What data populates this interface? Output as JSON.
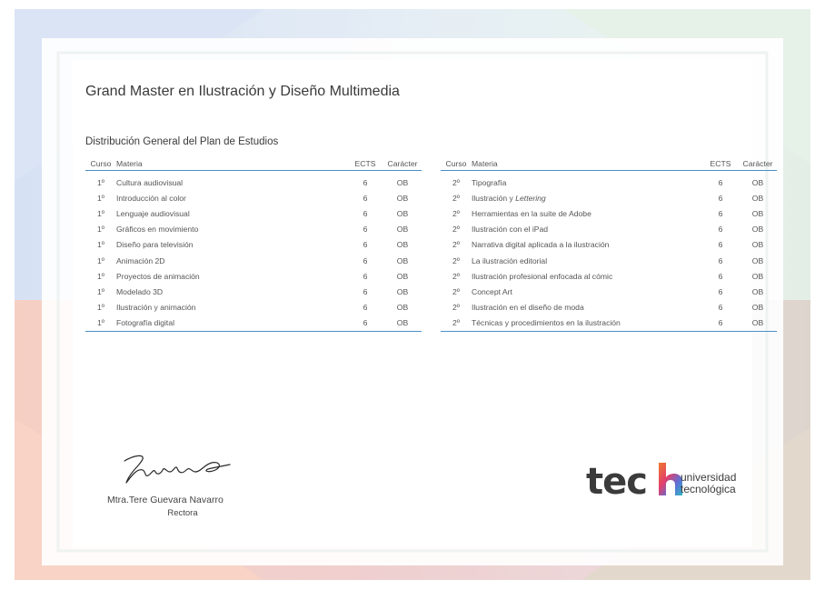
{
  "document": {
    "title": "Grand Master en Ilustración y Diseño Multimedia",
    "subtitle": "Distribución General del Plan de Estudios"
  },
  "table_headers": {
    "curso": "Curso",
    "materia": "Materia",
    "ects": "ECTS",
    "caracter": "Carácter"
  },
  "left_rows": [
    {
      "curso": "1º",
      "materia": "Cultura audiovisual",
      "ects": "6",
      "caracter": "OB"
    },
    {
      "curso": "1º",
      "materia": "Introducción al color",
      "ects": "6",
      "caracter": "OB"
    },
    {
      "curso": "1º",
      "materia": "Lenguaje audiovisual",
      "ects": "6",
      "caracter": "OB"
    },
    {
      "curso": "1º",
      "materia": "Gráficos en movimiento",
      "ects": "6",
      "caracter": "OB"
    },
    {
      "curso": "1º",
      "materia": "Diseño para televisión",
      "ects": "6",
      "caracter": "OB"
    },
    {
      "curso": "1º",
      "materia": "Animación 2D",
      "ects": "6",
      "caracter": "OB"
    },
    {
      "curso": "1º",
      "materia": "Proyectos de animación",
      "ects": "6",
      "caracter": "OB"
    },
    {
      "curso": "1º",
      "materia": "Modelado 3D",
      "ects": "6",
      "caracter": "OB"
    },
    {
      "curso": "1º",
      "materia": "Ilustración y animación",
      "ects": "6",
      "caracter": "OB"
    },
    {
      "curso": "1º",
      "materia": "Fotografía digital",
      "ects": "6",
      "caracter": "OB"
    }
  ],
  "right_rows": [
    {
      "curso": "2º",
      "materia": "Tipografía",
      "materia_em": "",
      "ects": "6",
      "caracter": "OB"
    },
    {
      "curso": "2º",
      "materia": "Ilustración y ",
      "materia_em": "Lettering",
      "ects": "6",
      "caracter": "OB"
    },
    {
      "curso": "2º",
      "materia": "Herramientas en la suite de Adobe",
      "materia_em": "",
      "ects": "6",
      "caracter": "OB"
    },
    {
      "curso": "2º",
      "materia": "Ilustración con el iPad",
      "materia_em": "",
      "ects": "6",
      "caracter": "OB"
    },
    {
      "curso": "2º",
      "materia": "Narrativa digital aplicada a la ilustración",
      "materia_em": "",
      "ects": "6",
      "caracter": "OB"
    },
    {
      "curso": "2º",
      "materia": "La ilustración editorial",
      "materia_em": "",
      "ects": "6",
      "caracter": "OB"
    },
    {
      "curso": "2º",
      "materia": "Ilustración profesional enfocada al cómic",
      "materia_em": "",
      "ects": "6",
      "caracter": "OB"
    },
    {
      "curso": "2º",
      "materia": "Concept Art",
      "materia_em": "",
      "ects": "6",
      "caracter": "OB"
    },
    {
      "curso": "2º",
      "materia": "Ilustración en el diseño de moda",
      "materia_em": "",
      "ects": "6",
      "caracter": "OB"
    },
    {
      "curso": "2º",
      "materia": "Técnicas y procedimientos en la ilustración",
      "materia_em": "",
      "ects": "6",
      "caracter": "OB"
    }
  ],
  "signature": {
    "name": "Mtra.Tere Guevara Navarro",
    "role": "Rectora"
  },
  "logo": {
    "brand": "tech",
    "line1": "universidad",
    "line2": "tecnológica"
  },
  "colors": {
    "accent_blue": "#4a8fc7",
    "logo_h_gradient": [
      "#f0782d",
      "#e23f6b",
      "#5d6fd6",
      "#2fb7c4"
    ]
  }
}
